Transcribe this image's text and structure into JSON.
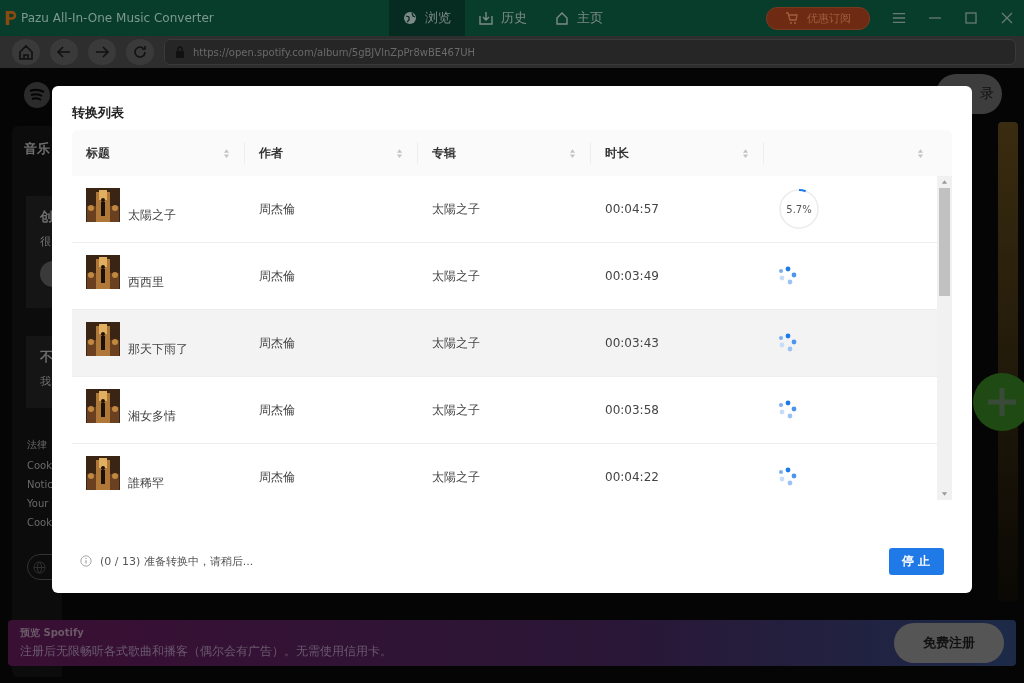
{
  "window": {
    "title": "Pazu All-In-One Music Converter"
  },
  "nav_tabs": [
    {
      "label": "浏览",
      "selected": true
    },
    {
      "label": "历史",
      "selected": false
    },
    {
      "label": "主页",
      "selected": false
    }
  ],
  "promo_button": {
    "label": "优惠订阅"
  },
  "address_bar": {
    "url": "https://open.spotify.com/album/5gBJVlnZpPr8wBE467UH"
  },
  "background_page": {
    "sidebar_heading": "音乐",
    "card_1": {
      "title": "创",
      "text": "很"
    },
    "card_2": {
      "title": "不",
      "text": "我"
    },
    "links": [
      "法律",
      "Cook",
      "Notic",
      "Your",
      "Cook"
    ],
    "login_button": "录"
  },
  "dialog": {
    "title": "转换列表",
    "columns": [
      "标题",
      "作者",
      "专辑",
      "时长"
    ],
    "rows": [
      {
        "title": "太陽之子",
        "artist": "周杰倫",
        "album": "太陽之子",
        "duration": "00:04:57",
        "status": {
          "kind": "progress",
          "level": 0.057,
          "reading": "5.7%"
        },
        "selected": false
      },
      {
        "title": "西西里",
        "artist": "周杰倫",
        "album": "太陽之子",
        "duration": "00:03:49",
        "status": {
          "kind": "waiting"
        },
        "selected": false
      },
      {
        "title": "那天下雨了",
        "artist": "周杰倫",
        "album": "太陽之子",
        "duration": "00:03:43",
        "status": {
          "kind": "waiting"
        },
        "selected": true
      },
      {
        "title": "湘女多情",
        "artist": "周杰倫",
        "album": "太陽之子",
        "duration": "00:03:58",
        "status": {
          "kind": "waiting"
        },
        "selected": false
      },
      {
        "title": "誰稀罕",
        "artist": "周杰倫",
        "album": "太陽之子",
        "duration": "00:04:22",
        "status": {
          "kind": "waiting"
        },
        "selected": false
      }
    ],
    "status_text": "(0 / 13) 准备转换中，请稍后...",
    "stop_button": "停止"
  },
  "banner": {
    "title": "预览 Spotify",
    "text": "注册后无限畅听各式歌曲和播客（偶尔会有广告）。无需使用信用卡。",
    "button": "免费注册"
  }
}
